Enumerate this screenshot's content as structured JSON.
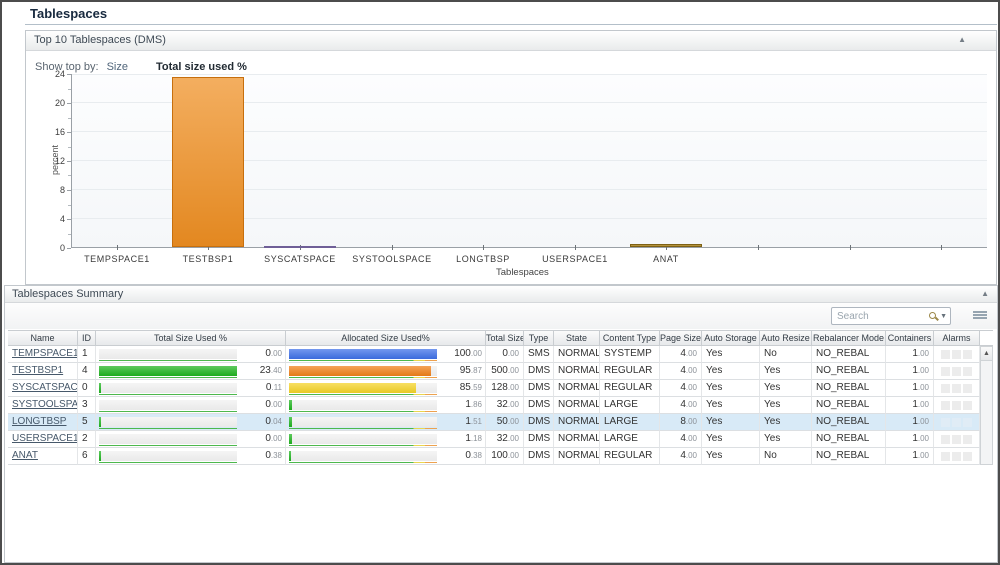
{
  "page": {
    "title": "Tablespaces"
  },
  "chart_panel": {
    "title": "Top 10 Tablespaces (DMS)",
    "collapse_icon": "▲",
    "show_top_by_label": "Show top by:",
    "options": [
      {
        "label": "Size",
        "selected": false
      },
      {
        "label": "Total size used %",
        "selected": true
      }
    ]
  },
  "chart_data": {
    "type": "bar",
    "title": "Top 10 Tablespaces (DMS)",
    "xlabel": "Tablespaces",
    "ylabel": "percent",
    "ylim": [
      0,
      24
    ],
    "yticks": [
      0,
      4,
      8,
      12,
      16,
      20,
      24
    ],
    "grid": true,
    "legend": "none",
    "slots": 10,
    "categories": [
      "TEMPSPACE1",
      "TESTBSP1",
      "SYSCATSPACE",
      "SYSTOOLSPACE",
      "LONGTBSP",
      "USERSPACE1",
      "ANAT"
    ],
    "values": [
      0,
      23.4,
      0.11,
      0,
      0.04,
      0,
      0.38
    ],
    "bar_fill": [
      "",
      "#ef8f22",
      "#8d7bb4",
      "",
      "",
      "",
      "#ad851e"
    ],
    "bar_border": [
      "",
      "#c76f0d",
      "#6f5f97",
      "",
      "",
      "",
      "#7e6114"
    ]
  },
  "summary_panel": {
    "title": "Tablespaces Summary",
    "collapse_icon": "▲",
    "search": {
      "placeholder": "Search"
    },
    "scroll_up_icon": "▲",
    "colors": {
      "gauge_green": "#1fb41f",
      "gauge_blue": "#3e70e8",
      "gauge_orange": "#f08018",
      "gauge_yellow": "#f5d327",
      "threshold_green": "#4db84d",
      "threshold_yellow": "#ead64f",
      "threshold_orange": "#eda24f",
      "selected_row": "#d8eaf7"
    },
    "table": {
      "columns": [
        "Name",
        "ID",
        "Total Size Used %",
        "Allocated Size Used%",
        "Total Size",
        "Type",
        "State",
        "Content Type",
        "Page Size",
        "Auto Storage",
        "Auto Resize",
        "Rebalancer Mode",
        "Containers",
        "Alarms"
      ],
      "rows": [
        {
          "name": "TEMPSPACE1",
          "id": "1",
          "total_used_pct": "0.00",
          "total_bar_pct": 0,
          "alloc_used_pct": "100.00",
          "alloc_bar_pct": 100,
          "alloc_color": "#3e70e8",
          "total_size": "0.00",
          "type": "SMS",
          "state": "NORMAL",
          "content_type": "SYSTEMP",
          "page_size": "4.00",
          "auto_storage": "Yes",
          "auto_resize": "No",
          "rebalancer_mode": "NO_REBAL",
          "containers": "1.00",
          "selected": false
        },
        {
          "name": "TESTBSP1",
          "id": "4",
          "total_used_pct": "23.40",
          "total_bar_pct": 100,
          "alloc_used_pct": "95.87",
          "alloc_bar_pct": 96,
          "alloc_color": "#f08018",
          "total_size": "500.00",
          "type": "DMS",
          "state": "NORMAL",
          "content_type": "REGULAR",
          "page_size": "4.00",
          "auto_storage": "Yes",
          "auto_resize": "Yes",
          "rebalancer_mode": "NO_REBAL",
          "containers": "1.00",
          "selected": false
        },
        {
          "name": "SYSCATSPACE",
          "id": "0",
          "total_used_pct": "0.11",
          "total_bar_pct": 0.5,
          "alloc_used_pct": "85.59",
          "alloc_bar_pct": 86,
          "alloc_color": "#f5d327",
          "total_size": "128.00",
          "type": "DMS",
          "state": "NORMAL",
          "content_type": "REGULAR",
          "page_size": "4.00",
          "auto_storage": "Yes",
          "auto_resize": "Yes",
          "rebalancer_mode": "NO_REBAL",
          "containers": "1.00",
          "selected": false
        },
        {
          "name": "SYSTOOLSPACE",
          "id": "3",
          "total_used_pct": "0.00",
          "total_bar_pct": 0,
          "alloc_used_pct": "1.86",
          "alloc_bar_pct": 2,
          "alloc_color": "#1fb41f",
          "total_size": "32.00",
          "type": "DMS",
          "state": "NORMAL",
          "content_type": "LARGE",
          "page_size": "4.00",
          "auto_storage": "Yes",
          "auto_resize": "Yes",
          "rebalancer_mode": "NO_REBAL",
          "containers": "1.00",
          "selected": false
        },
        {
          "name": "LONGTBSP",
          "id": "5",
          "total_used_pct": "0.04",
          "total_bar_pct": 0.2,
          "alloc_used_pct": "1.51",
          "alloc_bar_pct": 2,
          "alloc_color": "#1fb41f",
          "total_size": "50.00",
          "type": "DMS",
          "state": "NORMAL",
          "content_type": "LARGE",
          "page_size": "8.00",
          "auto_storage": "Yes",
          "auto_resize": "Yes",
          "rebalancer_mode": "NO_REBAL",
          "containers": "1.00",
          "selected": true
        },
        {
          "name": "USERSPACE1",
          "id": "2",
          "total_used_pct": "0.00",
          "total_bar_pct": 0,
          "alloc_used_pct": "1.18",
          "alloc_bar_pct": 2,
          "alloc_color": "#1fb41f",
          "total_size": "32.00",
          "type": "DMS",
          "state": "NORMAL",
          "content_type": "LARGE",
          "page_size": "4.00",
          "auto_storage": "Yes",
          "auto_resize": "Yes",
          "rebalancer_mode": "NO_REBAL",
          "containers": "1.00",
          "selected": false
        },
        {
          "name": "ANAT",
          "id": "6",
          "total_used_pct": "0.38",
          "total_bar_pct": 1.6,
          "alloc_used_pct": "0.38",
          "alloc_bar_pct": 1,
          "alloc_color": "#1fb41f",
          "total_size": "100.00",
          "type": "DMS",
          "state": "NORMAL",
          "content_type": "REGULAR",
          "page_size": "4.00",
          "auto_storage": "Yes",
          "auto_resize": "No",
          "rebalancer_mode": "NO_REBAL",
          "containers": "1.00",
          "selected": false
        }
      ]
    }
  }
}
